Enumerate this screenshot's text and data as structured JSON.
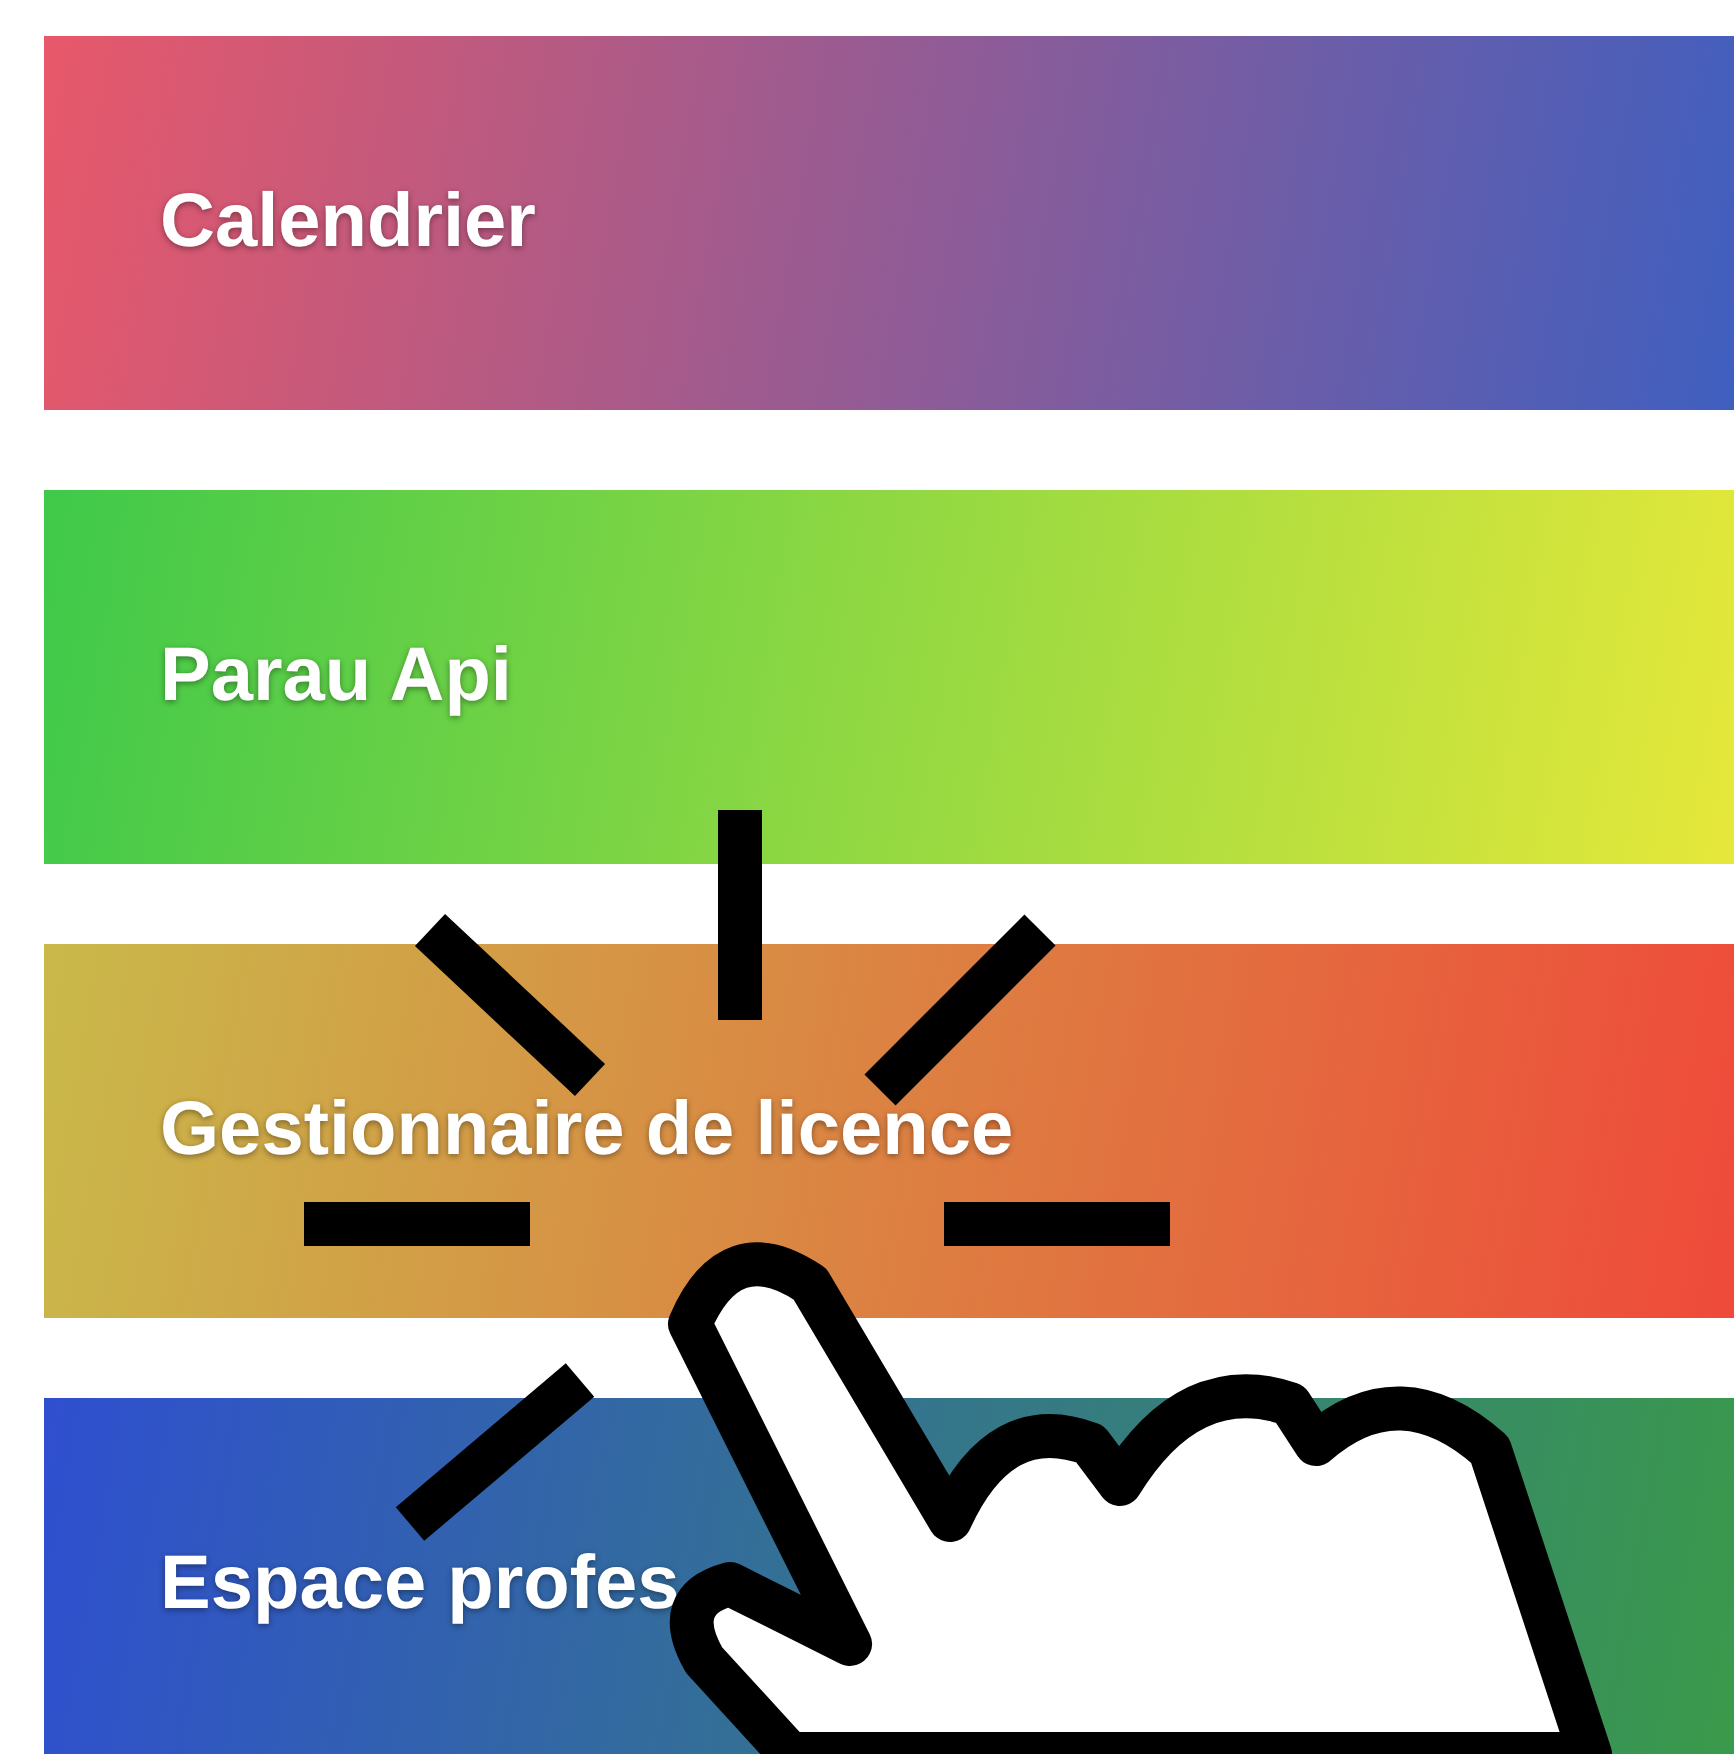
{
  "menu": [
    {
      "label": "Calendrier",
      "gradient": [
        {
          "color": "#e8586a"
        },
        {
          "color": "#3f5fbf"
        }
      ]
    },
    {
      "label": "Parau Api",
      "gradient": [
        {
          "color": "#3fc94a"
        },
        {
          "color": "#e6e83a"
        }
      ]
    },
    {
      "label": "Gestionnaire de licence",
      "gradient": [
        {
          "color": "#c9b94a"
        },
        {
          "color": "#ef4a3a"
        }
      ]
    },
    {
      "label": "Espace profes",
      "gradient": [
        {
          "color": "#2f4fd0"
        },
        {
          "color": "#3a9a4a"
        }
      ]
    }
  ]
}
